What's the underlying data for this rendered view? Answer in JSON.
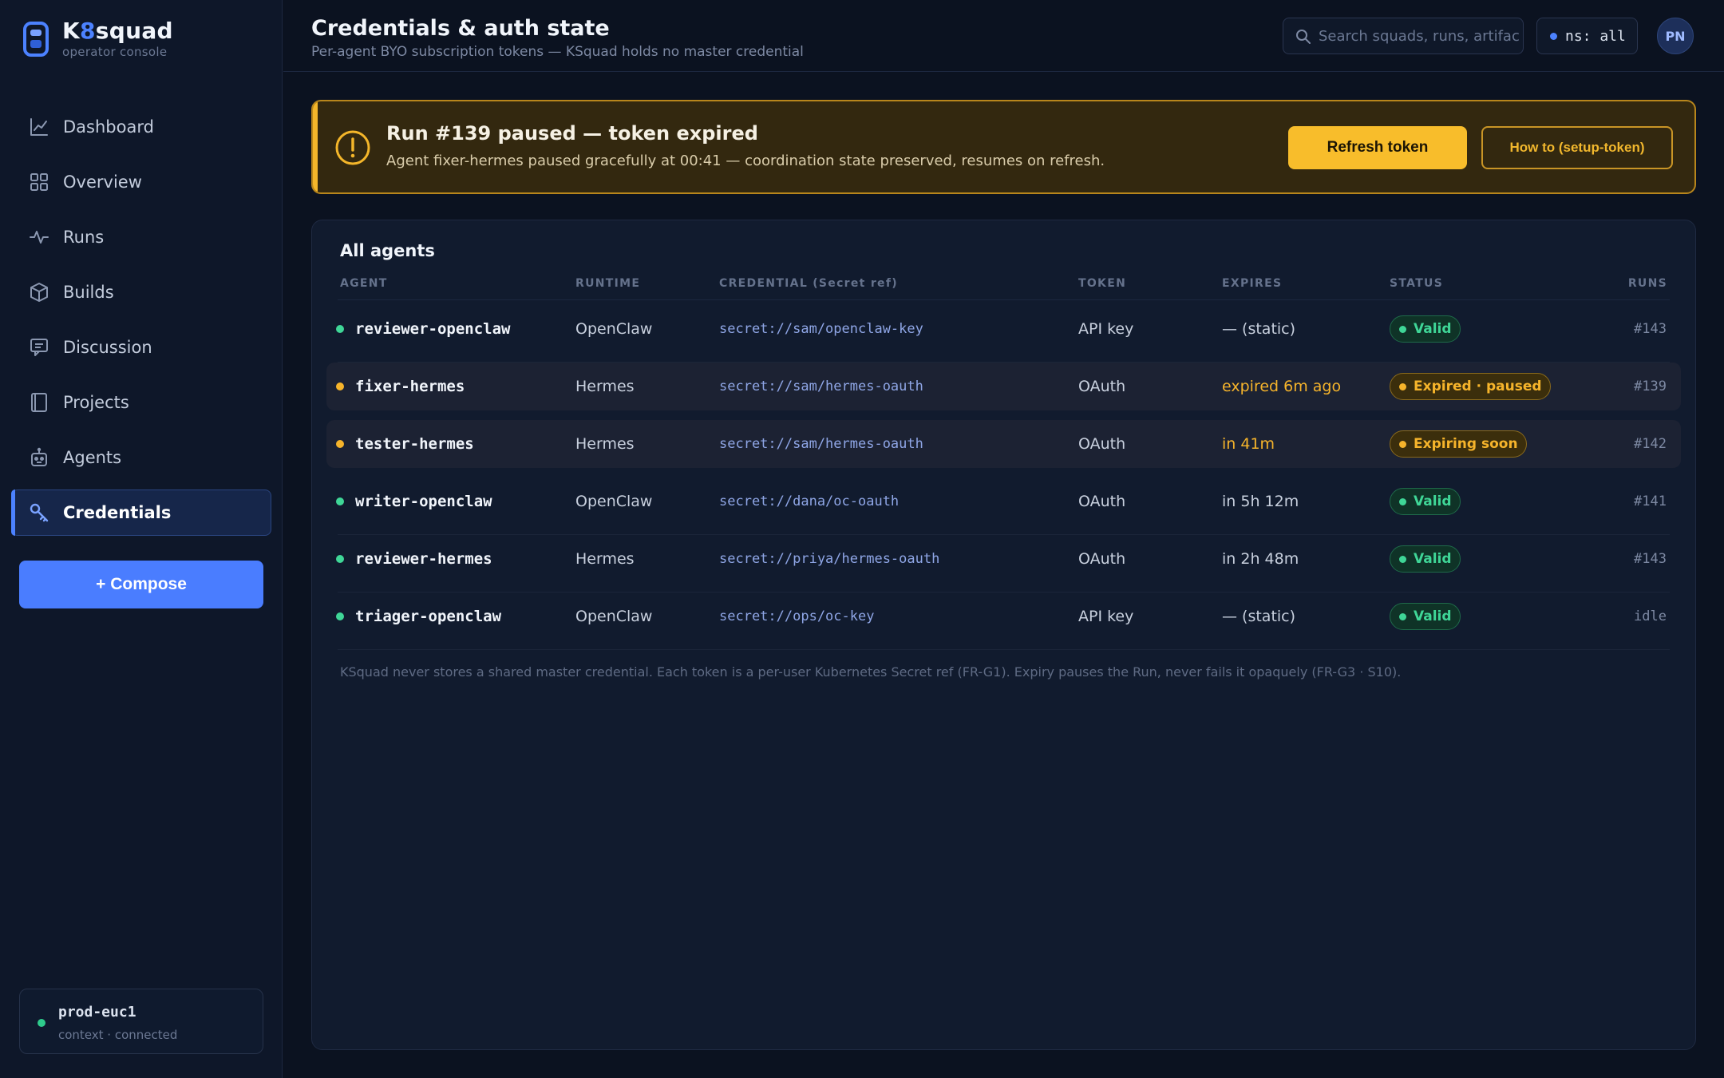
{
  "brand": {
    "name_prefix": "K",
    "name_accent": "8",
    "name_suffix": "squad",
    "subtitle": "operator console"
  },
  "sidebar": {
    "items": [
      {
        "label": "Dashboard",
        "icon": "chart-line-icon"
      },
      {
        "label": "Overview",
        "icon": "grid-icon"
      },
      {
        "label": "Runs",
        "icon": "activity-icon"
      },
      {
        "label": "Builds",
        "icon": "box-icon"
      },
      {
        "label": "Discussion",
        "icon": "chat-icon"
      },
      {
        "label": "Projects",
        "icon": "book-icon"
      },
      {
        "label": "Agents",
        "icon": "robot-icon"
      },
      {
        "label": "Credentials",
        "icon": "key-icon",
        "active": true
      }
    ],
    "compose_label": "+ Compose",
    "cluster": {
      "name": "prod-euc1",
      "status": "context · connected"
    }
  },
  "header": {
    "title": "Credentials & auth state",
    "subtitle": "Per-agent BYO subscription tokens — KSquad holds no master credential",
    "search_placeholder": "Search squads, runs, artifacts...",
    "namespace_label": "ns: all",
    "avatar_initials": "PN"
  },
  "alert": {
    "title": "Run #139 paused — token expired",
    "text": "Agent fixer-hermes paused gracefully at 00:41 — coordination state preserved, resumes on refresh.",
    "primary_label": "Refresh token",
    "secondary_label": "How to (setup-token)"
  },
  "table": {
    "title": "All agents",
    "columns": [
      "AGENT",
      "RUNTIME",
      "CREDENTIAL (Secret ref)",
      "TOKEN",
      "EXPIRES",
      "STATUS",
      "RUNS"
    ],
    "rows": [
      {
        "agent": "reviewer-openclaw",
        "runtime": "OpenClaw",
        "credential": "secret://sam/openclaw-key",
        "token": "API key",
        "expires": "— (static)",
        "status": "Valid",
        "state": "ok",
        "runs": "#143"
      },
      {
        "agent": "fixer-hermes",
        "runtime": "Hermes",
        "credential": "secret://sam/hermes-oauth",
        "token": "OAuth",
        "expires": "expired 6m ago",
        "status": "Expired · paused",
        "state": "warn",
        "runs": "#139"
      },
      {
        "agent": "tester-hermes",
        "runtime": "Hermes",
        "credential": "secret://sam/hermes-oauth",
        "token": "OAuth",
        "expires": "in 41m",
        "status": "Expiring soon",
        "state": "warn",
        "runs": "#142"
      },
      {
        "agent": "writer-openclaw",
        "runtime": "OpenClaw",
        "credential": "secret://dana/oc-oauth",
        "token": "OAuth",
        "expires": "in 5h 12m",
        "status": "Valid",
        "state": "ok",
        "runs": "#141"
      },
      {
        "agent": "reviewer-hermes",
        "runtime": "Hermes",
        "credential": "secret://priya/hermes-oauth",
        "token": "OAuth",
        "expires": "in 2h 48m",
        "status": "Valid",
        "state": "ok",
        "runs": "#143"
      },
      {
        "agent": "triager-openclaw",
        "runtime": "OpenClaw",
        "credential": "secret://ops/oc-key",
        "token": "API key",
        "expires": "— (static)",
        "status": "Valid",
        "state": "ok",
        "runs": "idle"
      }
    ],
    "footnote": "KSquad never stores a shared master credential. Each token is a per-user Kubernetes Secret ref (FR-G1). Expiry pauses the Run, never fails it opaquely (FR-G3 · S10)."
  },
  "colors": {
    "accent": "#4c82ff",
    "ok": "#3fd697",
    "warn": "#f6b42b",
    "background": "#0b1220"
  }
}
